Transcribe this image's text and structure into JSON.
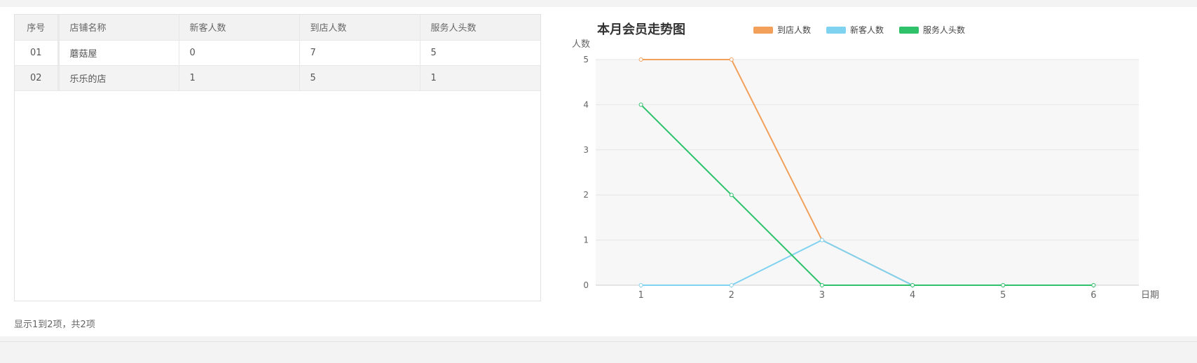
{
  "table": {
    "headers": [
      "序号",
      "店铺名称",
      "新客人数",
      "到店人数",
      "服务人头数"
    ],
    "rows": [
      [
        "01",
        "蘑菇屋",
        "0",
        "7",
        "5"
      ],
      [
        "02",
        "乐乐的店",
        "1",
        "5",
        "1"
      ]
    ]
  },
  "pager": {
    "info": "显示1到2项，共2项"
  },
  "chart_data": {
    "type": "line",
    "title": "本月会员走势图",
    "xlabel": "日期",
    "ylabel": "人数",
    "x": [
      1,
      2,
      3,
      4,
      5,
      6
    ],
    "ylim": [
      0,
      5
    ],
    "yticks": [
      0,
      1,
      2,
      3,
      4,
      5
    ],
    "grid": true,
    "legend_position": "top",
    "series": [
      {
        "name": "到店人数",
        "color": "#f2a05a",
        "values": [
          5,
          5,
          1,
          0,
          0,
          0
        ]
      },
      {
        "name": "新客人数",
        "color": "#7fd3f0",
        "values": [
          0,
          0,
          1,
          0,
          0,
          0
        ]
      },
      {
        "name": "服务人头数",
        "color": "#2fc26b",
        "values": [
          4,
          2,
          0,
          0,
          0,
          0
        ]
      }
    ]
  }
}
